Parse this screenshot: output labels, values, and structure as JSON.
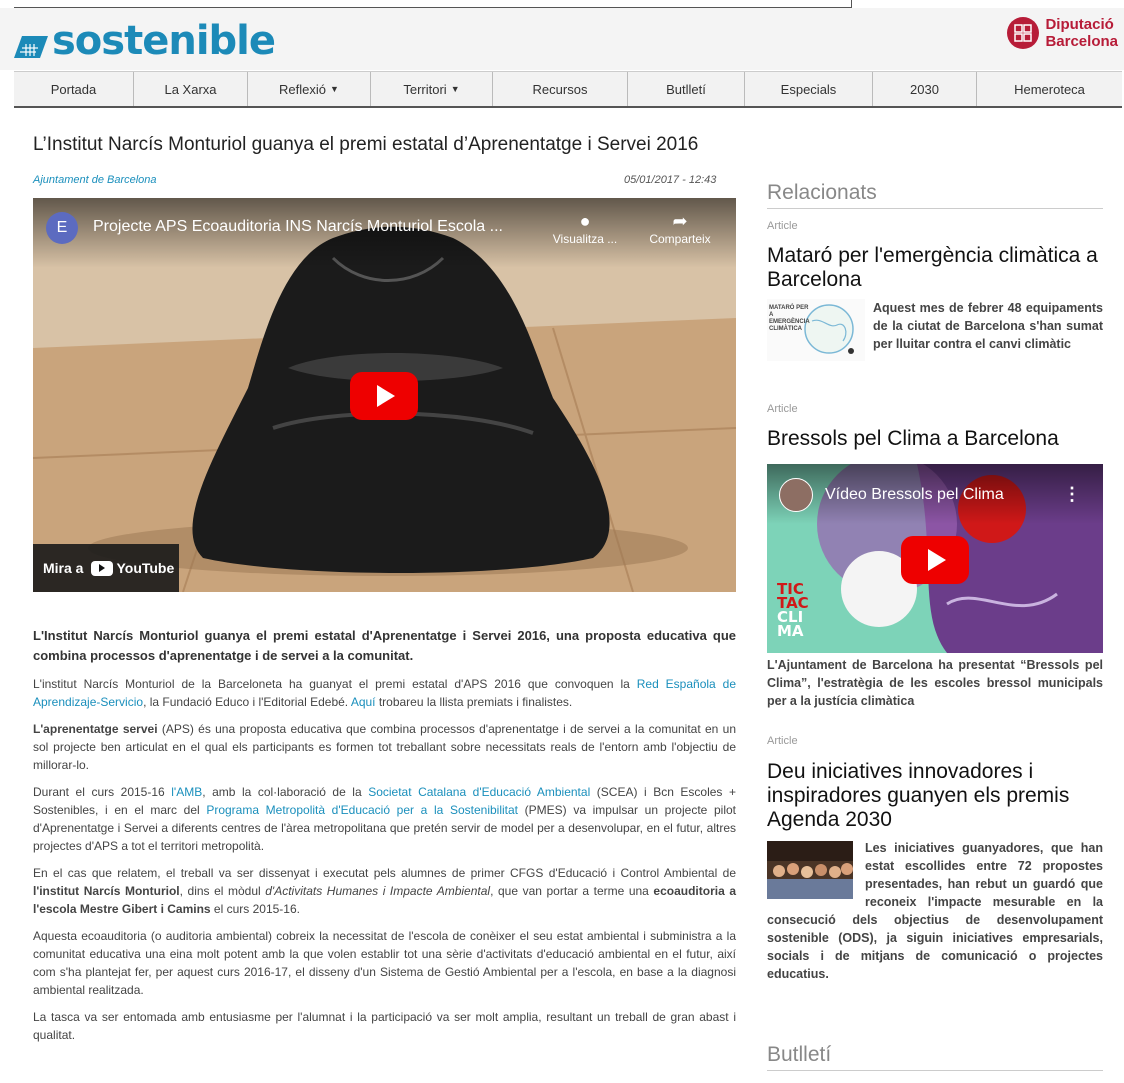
{
  "site": {
    "logo_text": "sostenible",
    "partner_line1": "Diputació",
    "partner_line2": "Barcelona"
  },
  "nav": [
    {
      "label": "Portada",
      "caret": false
    },
    {
      "label": "La Xarxa",
      "caret": false
    },
    {
      "label": "Reflexió",
      "caret": true
    },
    {
      "label": "Territori",
      "caret": true
    },
    {
      "label": "Recursos",
      "caret": false
    },
    {
      "label": "Butlletí",
      "caret": false
    },
    {
      "label": "Especials",
      "caret": false
    },
    {
      "label": "2030",
      "caret": false
    },
    {
      "label": "Hemeroteca",
      "caret": false
    }
  ],
  "article": {
    "title": "L’Institut Narcís Monturiol guanya el premi estatal d’Aprenentatge i Servei 2016",
    "source": "Ajuntament de Barcelona",
    "date": "05/01/2017 - 12:43",
    "video": {
      "channel_initial": "E",
      "title": "Projecte APS Ecoauditoria INS Narcís Monturiol Escola ...",
      "watch_later": "Visualitza ...",
      "share": "Comparteix",
      "watch_on": "Mira a",
      "youtube": "YouTube"
    },
    "lead": "L'Institut Narcís Monturiol guanya el premi estatal d'Aprenentatge i Servei 2016, una proposta educativa que combina processos d'aprenentatge i de servei a la comunitat.",
    "p1": {
      "a": "L'institut Narcís Monturiol de la Barceloneta ha guanyat el premi estatal d'APS 2016 que convoquen la ",
      "link1": "Red Española de Aprendizaje-Servicio",
      "b": ", la Fundació Educo i l'Editorial Edebé. ",
      "link2": "Aquí",
      "c": " trobareu la llista premiats i finalistes."
    },
    "p2": {
      "bold": "L'aprenentatge servei",
      "rest": " (APS) és una proposta educativa que combina processos d'aprenentatge i de servei a la comunitat en un sol projecte ben articulat en el qual els participants es formen tot treballant sobre necessitats reals de l'entorn amb l'objectiu de millorar-lo."
    },
    "p3": {
      "a": "Durant el curs 2015-16 ",
      "link1": "l'AMB",
      "b": ", amb la col·laboració de la ",
      "link2": "Societat Catalana d'Educació Ambiental",
      "c": " (SCEA) i Bcn Escoles + Sostenibles, i en el marc del ",
      "link3": "Programa Metropolità d'Educació per a la Sostenibilitat",
      "d": " (PMES) va impulsar un projecte pilot d'Aprenentatge i Servei a diferents centres de l'àrea metropolitana que pretén servir de model per a desenvolupar, en el futur, altres projectes d'APS a tot el territori metropolità."
    },
    "p4": {
      "a": "En el cas que relatem, el treball va ser dissenyat i executat pels alumnes de primer CFGS d'Educació i Control Ambiental de ",
      "bold1": "l'institut Narcís Monturiol",
      "b": ", dins el mòdul ",
      "italic": "d'Activitats Humanes i Impacte Ambiental",
      "c": ", que van portar a terme una ",
      "bold2": "ecoauditoria a l'escola Mestre Gibert i Camins",
      "d": " el curs 2015-16."
    },
    "p5": "Aquesta ecoauditoria (o auditoria ambiental) cobreix la necessitat de l'escola de conèixer el seu estat ambiental i subministra a la comunitat educativa una eina molt potent amb la que volen establir tot una sèrie d'activitats d'educació ambiental en el futur, així com s'ha plantejat fer, per aquest curs 2016-17, el disseny d'un Sistema de Gestió Ambiental per a l'escola, en base a la diagnosi ambiental realitzada.",
    "p6": "La tasca va ser entomada amb entusiasme per l'alumnat i la participació va ser molt amplia, resultant un treball de gran abast i qualitat."
  },
  "sidebar": {
    "related_heading": "Relacionats",
    "items": [
      {
        "tag": "Article",
        "title": "Mataró per l'emergència climàtica a Barcelona",
        "thumb_text": "MATARÓ PER A EMERGÈNCIA CLIMÀTICA",
        "summary": "Aquest mes de febrer 48 equipaments de la ciutat de Barcelona s'han sumat per lluitar contra el canvi climàtic"
      },
      {
        "tag": "Article",
        "title": "Bressols pel Clima a Barcelona",
        "video_title": "Vídeo Bressols pel Clima",
        "video_logo": [
          "TIC",
          "TAC",
          "CLI",
          "MA"
        ],
        "summary": "L'Ajuntament de Barcelona ha presentat “Bressols pel Clima”, l'estratègia de les escoles bressol municipals per a la justícia climàtica"
      },
      {
        "tag": "Article",
        "title": "Deu iniciatives innovadores i inspiradores guanyen els premis Agenda 2030",
        "summary": "Les iniciatives guanyadores, que han estat escollides entre 72 propostes presentades, han rebut un guardó que reconeix l'impacte mesurable en la consecució dels objectius de desenvolupament sostenible (ODS), ja siguin iniciatives empresarials, socials i de mitjans de comunicació o projectes educatius."
      }
    ],
    "newsletter_heading": "Butlletí"
  }
}
